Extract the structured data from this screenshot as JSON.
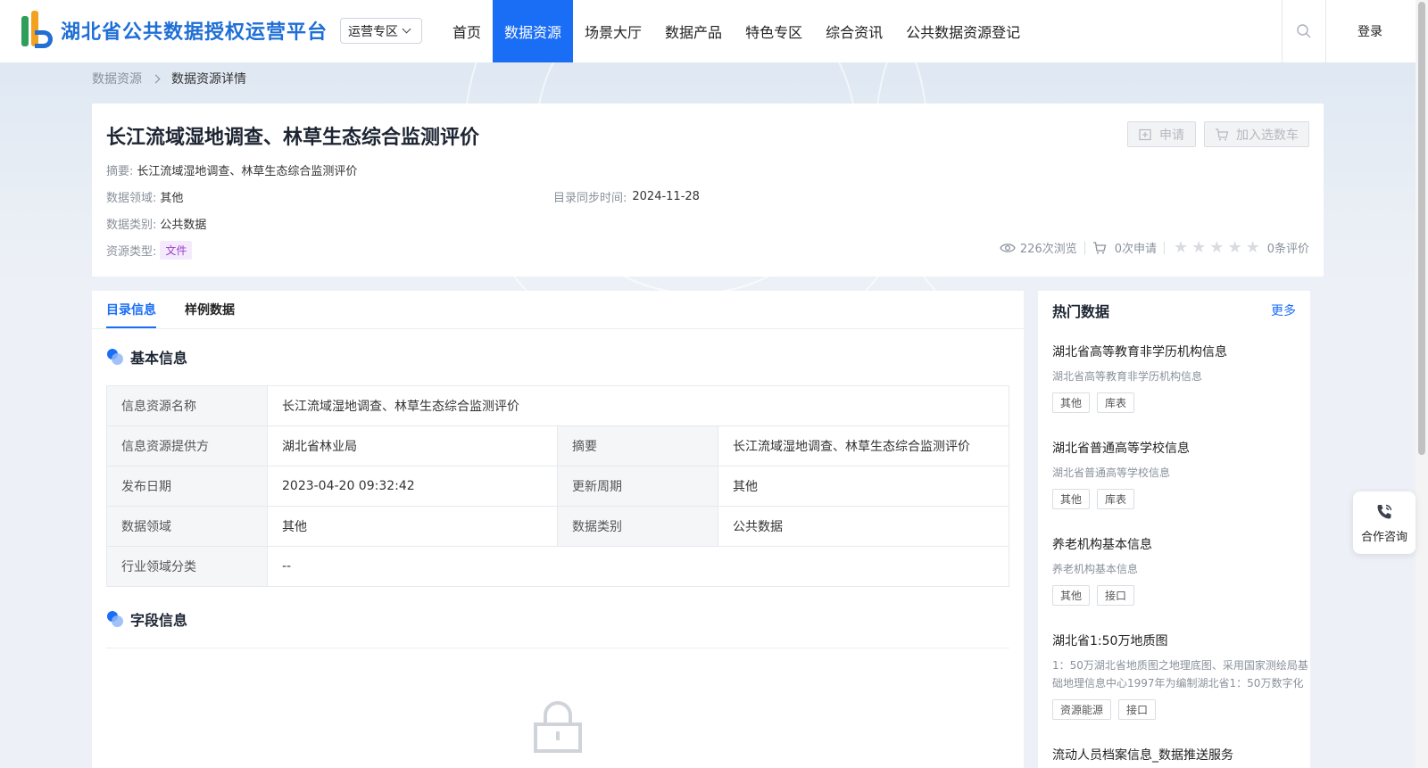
{
  "header": {
    "logo_text": "湖北省公共数据授权运营平台",
    "zone_select": "运营专区",
    "nav": [
      {
        "label": "首页",
        "active": false
      },
      {
        "label": "数据资源",
        "active": true
      },
      {
        "label": "场景大厅",
        "active": false
      },
      {
        "label": "数据产品",
        "active": false
      },
      {
        "label": "特色专区",
        "active": false
      },
      {
        "label": "综合资讯",
        "active": false
      },
      {
        "label": "公共数据资源登记",
        "active": false
      }
    ],
    "login": "登录"
  },
  "breadcrumb": [
    "数据资源",
    "数据资源详情"
  ],
  "summary": {
    "title": "长江流域湿地调查、林草生态综合监测评价",
    "apply_label": "申请",
    "cart_label": "加入选数车",
    "abstract_label": "摘要:",
    "abstract": "长江流域湿地调查、林草生态综合监测评价",
    "domain_label": "数据领域:",
    "domain": "其他",
    "sync_label": "目录同步时间:",
    "sync_time": "2024-11-28",
    "category_label": "数据类别:",
    "category": "公共数据",
    "resource_type_label": "资源类型:",
    "resource_type": "文件",
    "views": "226次浏览",
    "applies": "0次申请",
    "rating_stars": 0,
    "reviews": "0条评价"
  },
  "tabs": [
    {
      "label": "目录信息",
      "active": true
    },
    {
      "label": "样例数据",
      "active": false
    }
  ],
  "basic_info": {
    "heading": "基本信息",
    "rows": [
      {
        "k1": "信息资源名称",
        "v1": "长江流域湿地调查、林草生态综合监测评价"
      },
      {
        "k1": "信息资源提供方",
        "v1": "湖北省林业局",
        "k2": "摘要",
        "v2": "长江流域湿地调查、林草生态综合监测评价"
      },
      {
        "k1": "发布日期",
        "v1": "2023-04-20 09:32:42",
        "k2": "更新周期",
        "v2": "其他"
      },
      {
        "k1": "数据领域",
        "v1": "其他",
        "k2": "数据类别",
        "v2": "公共数据"
      },
      {
        "k1": "行业领域分类",
        "v1": "--"
      }
    ]
  },
  "field_info": {
    "heading": "字段信息"
  },
  "hot": {
    "title": "热门数据",
    "more": "更多",
    "items": [
      {
        "name": "湖北省高等教育非学历机构信息",
        "desc": "湖北省高等教育非学历机构信息",
        "tags": [
          "其他",
          "库表"
        ]
      },
      {
        "name": "湖北省普通高等学校信息",
        "desc": "湖北省普通高等学校信息",
        "tags": [
          "其他",
          "库表"
        ]
      },
      {
        "name": "养老机构基本信息",
        "desc": "养老机构基本信息",
        "tags": [
          "其他",
          "接口"
        ]
      },
      {
        "name": "湖北省1:50万地质图",
        "desc": "1：50万湖北省地质图之地理底图、采用国家测绘局基础地理信息中心1997年为编制湖北省1：50万数字化地",
        "tags": [
          "资源能源",
          "接口"
        ]
      },
      {
        "name": "流动人员档案信息_数据推送服务",
        "desc": "",
        "tags": []
      }
    ]
  },
  "consult": "合作咨询",
  "colors": {
    "primary": "#1a6ef5",
    "tag_purple": "#9b3fd0"
  }
}
